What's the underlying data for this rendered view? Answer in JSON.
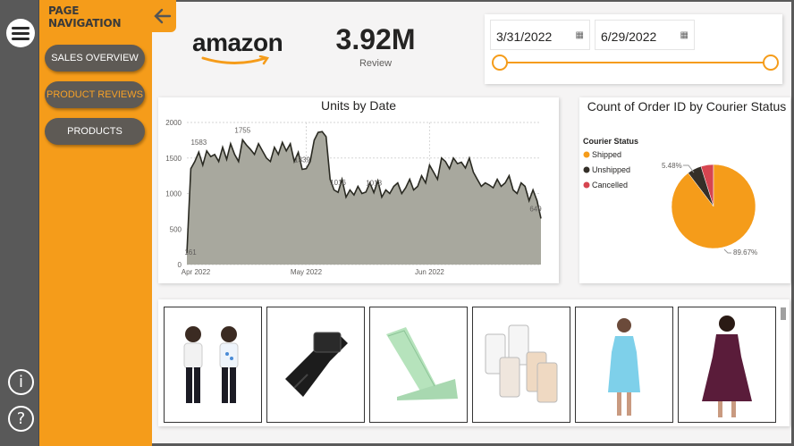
{
  "nav": {
    "title": "PAGE NAVIGATION",
    "buttons": [
      {
        "label": "SALES OVERVIEW",
        "active": false
      },
      {
        "label": "PRODUCT REVIEWS",
        "active": true
      },
      {
        "label": "PRODUCTS",
        "active": false
      }
    ]
  },
  "rail": {
    "icons": [
      "menu-icon",
      "info-icon",
      "help-icon"
    ],
    "info_glyph": "i",
    "help_glyph": "?"
  },
  "brand": {
    "name": "amazon"
  },
  "kpi": {
    "value": "3.92M",
    "label": "Review"
  },
  "date_slicer": {
    "start": "3/31/2022",
    "end": "6/29/2022",
    "range": [
      0,
      1
    ]
  },
  "colors": {
    "accent": "#f59c1a",
    "area": "#a8a89e",
    "line": "#2a2a22",
    "shipped": "#f59c1a",
    "unshipped": "#342f28",
    "cancelled": "#d64550"
  },
  "chart_data": [
    {
      "type": "area",
      "title": "Units by Date",
      "x_tick_labels": [
        "Apr 2022",
        "May 2022",
        "Jun 2022"
      ],
      "y_tick_labels": [
        "0",
        "500",
        "1000",
        "1500",
        "2000"
      ],
      "ylim": [
        0,
        2000
      ],
      "x": [
        0,
        1,
        2,
        3,
        4,
        5,
        6,
        7,
        8,
        9,
        10,
        11,
        12,
        13,
        14,
        15,
        16,
        17,
        18,
        19,
        20,
        21,
        22,
        23,
        24,
        25,
        26,
        27,
        28,
        29,
        30,
        31,
        32,
        33,
        34,
        35,
        36,
        37,
        38,
        39,
        40,
        41,
        42,
        43,
        44,
        45,
        46,
        47,
        48,
        49,
        50,
        51,
        52,
        53,
        54,
        55,
        56,
        57,
        58,
        59,
        60,
        61,
        62,
        63,
        64,
        65,
        66,
        67,
        68,
        69,
        70,
        71,
        72,
        73,
        74,
        75,
        76,
        77,
        78,
        79,
        80,
        81,
        82,
        83,
        84,
        85,
        86,
        87,
        88,
        89
      ],
      "values": [
        161,
        1350,
        1450,
        1583,
        1400,
        1600,
        1520,
        1550,
        1450,
        1650,
        1480,
        1700,
        1550,
        1450,
        1755,
        1680,
        1620,
        1550,
        1700,
        1600,
        1500,
        1450,
        1650,
        1550,
        1720,
        1600,
        1700,
        1450,
        1580,
        1339,
        1350,
        1450,
        1750,
        1860,
        1870,
        1800,
        1200,
        1050,
        1016,
        1200,
        950,
        1050,
        980,
        1100,
        1000,
        1020,
        1150,
        1013,
        1180,
        950,
        1050,
        1000,
        1100,
        1150,
        1000,
        1080,
        1200,
        1050,
        1100,
        1250,
        1150,
        1400,
        1300,
        1200,
        1500,
        1450,
        1350,
        1500,
        1420,
        1440,
        1360,
        1500,
        1300,
        1200,
        1100,
        1150,
        1120,
        1080,
        1200,
        1100,
        1150,
        1250,
        1050,
        1000,
        1150,
        1100,
        900,
        1050,
        900,
        649
      ],
      "data_labels": [
        {
          "x": 0,
          "text": "161"
        },
        {
          "x": 3,
          "text": "1583"
        },
        {
          "x": 14,
          "text": "1755"
        },
        {
          "x": 29,
          "text": "1339"
        },
        {
          "x": 38,
          "text": "1016"
        },
        {
          "x": 47,
          "text": "1013"
        },
        {
          "x": 89,
          "text": "649"
        }
      ],
      "grid": true
    },
    {
      "type": "pie",
      "title": "Count of Order ID by Courier Status",
      "legend_title": "Courier Status",
      "slices": [
        {
          "name": "Shipped",
          "value": 89.67,
          "label": "89.67%"
        },
        {
          "name": "Unshipped",
          "value": 5.48,
          "label": "5.48%"
        },
        {
          "name": "Cancelled",
          "value": 4.85
        }
      ],
      "legend_position": "left"
    }
  ],
  "gallery": {
    "products": [
      "kids-tshirt-product",
      "black-belt-product",
      "green-tie-product",
      "bra-extender-product",
      "blue-dress-product",
      "maroon-dress-product"
    ]
  }
}
